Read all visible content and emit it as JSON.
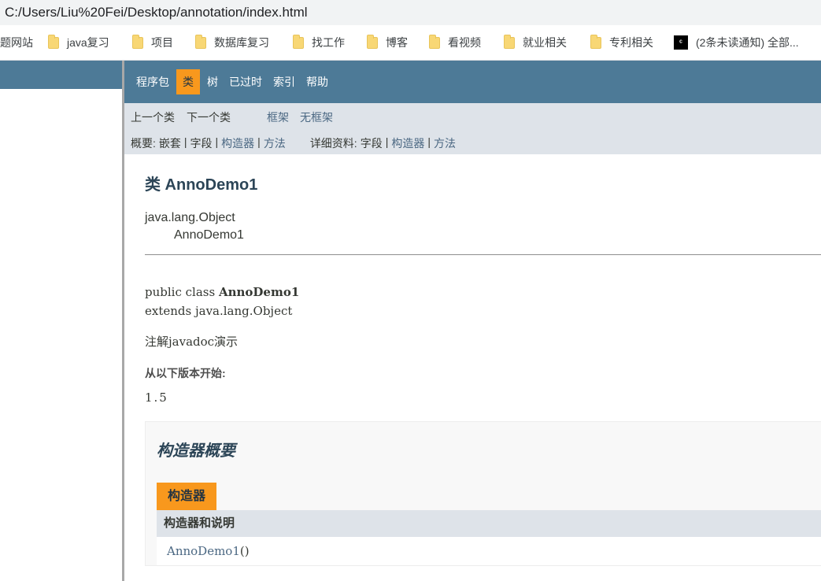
{
  "browser": {
    "url": "C:/Users/Liu%20Fei/Desktop/annotation/index.html",
    "bookmarks": [
      {
        "label": "题网站",
        "icon": "none"
      },
      {
        "label": "java复习",
        "icon": "folder-icon"
      },
      {
        "label": "项目",
        "icon": "folder-icon"
      },
      {
        "label": "数据库复习",
        "icon": "folder-icon"
      },
      {
        "label": "找工作",
        "icon": "folder-icon"
      },
      {
        "label": "博客",
        "icon": "folder-icon"
      },
      {
        "label": "看视频",
        "icon": "folder-icon"
      },
      {
        "label": "就业相关",
        "icon": "folder-icon"
      },
      {
        "label": "专利相关",
        "icon": "folder-icon"
      },
      {
        "label": "(2条未读通知) 全部...",
        "icon": "app-icon"
      }
    ]
  },
  "javadoc": {
    "topnav": [
      "程序包",
      "类",
      "树",
      "已过时",
      "索引",
      "帮助"
    ],
    "active_tab": "类",
    "subnav": {
      "prev_class": "上一个类",
      "next_class": "下一个类",
      "frames": "框架",
      "no_frames": "无框架",
      "summary_label": "概要:",
      "summary_nested": "嵌套",
      "summary_field": "字段",
      "summary_ctor": "构造器",
      "summary_method": "方法",
      "detail_label": "详细资料:",
      "detail_field": "字段",
      "detail_ctor": "构造器",
      "detail_method": "方法",
      "sep": "|"
    },
    "class_title": "类 AnnoDemo1",
    "inheritance": {
      "parent": "java.lang.Object",
      "child": "AnnoDemo1"
    },
    "signature": {
      "prefix": "public class ",
      "name": "AnnoDemo1",
      "extends": "extends java.lang.Object"
    },
    "description": "注解javadoc演示",
    "since_label": "从以下版本开始:",
    "since_value": "1.5",
    "constructor_summary": {
      "title": "构造器概要",
      "tab": "构造器",
      "column": "构造器和说明",
      "row_name": "AnnoDemo1",
      "row_parens": "()"
    }
  },
  "colors": {
    "nav_bg": "#4d7a97",
    "active_tab_bg": "#f8981d",
    "subnav_bg": "#dee3e9",
    "link": "#4a6782"
  }
}
